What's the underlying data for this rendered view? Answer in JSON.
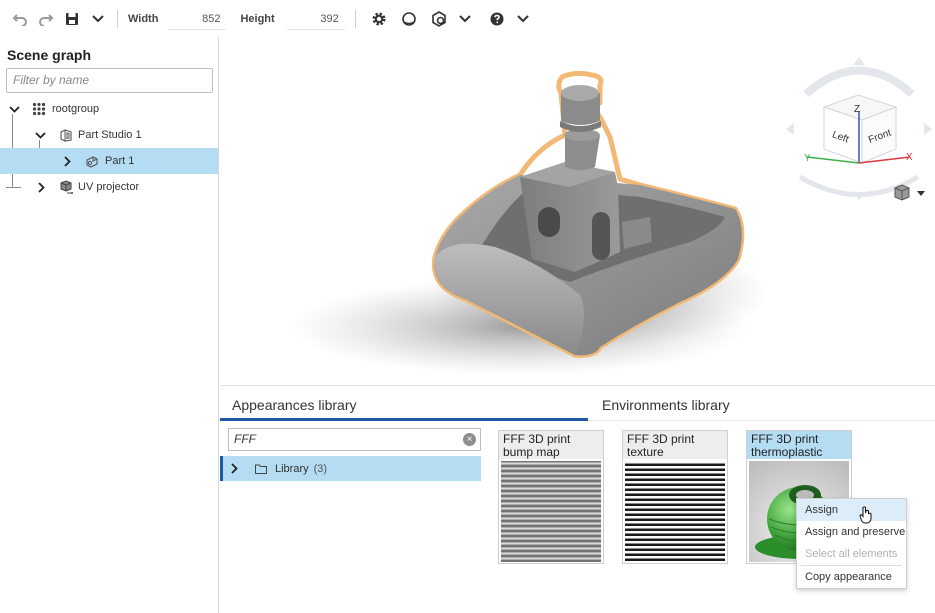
{
  "toolbar": {
    "undo_icon": "undo-icon",
    "redo_icon": "redo-icon",
    "save_icon": "save-icon",
    "width_label": "Width",
    "width_value": "852",
    "height_label": "Height",
    "height_value": "392"
  },
  "scene_graph": {
    "title": "Scene graph",
    "filter_placeholder": "Filter by name",
    "items": [
      {
        "label": "rootgroup",
        "icon": "grid-group-icon"
      },
      {
        "label": "Part Studio 1",
        "icon": "part-studio-icon"
      },
      {
        "label": "Part 1",
        "icon": "part-icon",
        "selected": true
      },
      {
        "label": "UV projector",
        "icon": "uv-projector-icon"
      }
    ]
  },
  "viewcube": {
    "top": "Z",
    "left": "Left",
    "front": "Front",
    "axis_x": "X",
    "axis_y": "Y"
  },
  "bottom": {
    "tab_appearances": "Appearances library",
    "tab_environments": "Environments library",
    "search_value": "FFF",
    "library_label": "Library",
    "library_count": "(3)",
    "cards": [
      {
        "line1": "FFF 3D print",
        "line2": "bump map"
      },
      {
        "line1": "FFF 3D print",
        "line2": "texture"
      },
      {
        "line1": "FFF 3D print",
        "line2": "thermoplastic"
      }
    ]
  },
  "context_menu": {
    "items": [
      "Assign",
      "Assign and preserve",
      "Select all elements",
      "Copy appearance"
    ]
  },
  "colors": {
    "selection": "#b4dcf3",
    "accent": "#1d57a6",
    "highlight_outline": "#f2b976"
  }
}
